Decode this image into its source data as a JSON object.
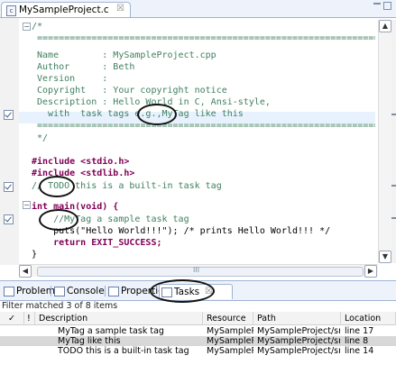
{
  "editor": {
    "tab_label": "MySampleProject.c",
    "tab_close": "☒",
    "file_icon": "c",
    "lines": [
      "/*",
      " ==========================================================================",
      " Name        : MySampleProject.cpp",
      " Author      : Beth",
      " Version     :",
      " Copyright   : Your copyright notice",
      " Description : Hello World in C, Ansi-style,",
      "   with  task tags e.g.,MyTag like this",
      " ==========================================================================",
      " */",
      "",
      "#include <stdio.h>",
      "#include <stdlib.h>",
      "// TODO this is a built-in task tag",
      "",
      "int main(void) {",
      "    //MyTag a sample task tag",
      "    puts(\"Hello World!!!\"); /* prints Hello World!!! */",
      "    return EXIT_SUCCESS;",
      "}"
    ],
    "hscroll_label": "III"
  },
  "views": {
    "tabs": [
      {
        "label": "Problems",
        "icon": "problems-icon"
      },
      {
        "label": "Console",
        "icon": "console-icon"
      },
      {
        "label": "Properties",
        "icon": "properties-icon"
      },
      {
        "label": "Tasks",
        "icon": "tasks-icon"
      }
    ],
    "tasks_close": "☒",
    "filter_text": "Filter matched 3 of 8 items"
  },
  "tasks_table": {
    "columns": [
      "✓",
      "!",
      "Description",
      "Resource",
      "Path",
      "Location"
    ],
    "rows": [
      {
        "description": "MyTag a sample task tag",
        "resource": "MySamplePr...",
        "path": "MySampleProject/src",
        "location": "line 17"
      },
      {
        "description": "MyTag like this",
        "resource": "MySamplePr...",
        "path": "MySampleProject/src",
        "location": "line 8"
      },
      {
        "description": "TODO this is a built-in task tag",
        "resource": "MySamplePr...",
        "path": "MySampleProject/src",
        "location": "line 14"
      }
    ]
  },
  "colors": {
    "comment": "#3f7f5f",
    "keyword": "#7f0055",
    "string": "#2a00ff",
    "task_tag": "#7f9fbf",
    "highlight": "#e8f2fe",
    "tab_bar": "#eef3fb"
  }
}
